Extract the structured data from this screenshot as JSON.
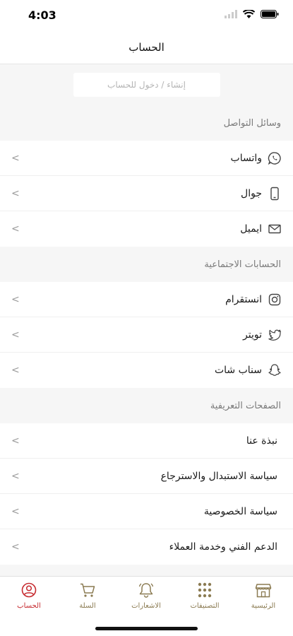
{
  "status": {
    "time": "4:03"
  },
  "header": {
    "title": "الحساب"
  },
  "login": {
    "label": "إنشاء / دخول للحساب"
  },
  "sections": [
    {
      "title": "وسائل التواصل",
      "items": [
        {
          "label": "واتساب",
          "icon": "whatsapp-icon"
        },
        {
          "label": "جوال",
          "icon": "phone-icon"
        },
        {
          "label": "ايميل",
          "icon": "email-icon"
        }
      ]
    },
    {
      "title": "الحسابات الاجتماعية",
      "items": [
        {
          "label": "انستقرام",
          "icon": "instagram-icon"
        },
        {
          "label": "تويتر",
          "icon": "twitter-icon"
        },
        {
          "label": "سناب شات",
          "icon": "snapchat-icon"
        }
      ]
    },
    {
      "title": "الصفحات التعريفية",
      "items": [
        {
          "label": "نبذة عنا"
        },
        {
          "label": "سياسة الاستبدال والاسترجاع"
        },
        {
          "label": "سياسة الخصوصية"
        },
        {
          "label": "الدعم الفني وخدمة العملاء"
        }
      ]
    }
  ],
  "tabs": [
    {
      "label": "الرئيسية",
      "icon": "store-icon"
    },
    {
      "label": "التصنيفات",
      "icon": "grid-icon"
    },
    {
      "label": "الاشعارات",
      "icon": "bell-icon"
    },
    {
      "label": "السلة",
      "icon": "cart-icon"
    },
    {
      "label": "الحساب",
      "icon": "account-icon",
      "active": true
    }
  ],
  "colors": {
    "accent": "#8b7b52",
    "active": "#c62a2f",
    "section_bg": "#f6f6f6"
  }
}
